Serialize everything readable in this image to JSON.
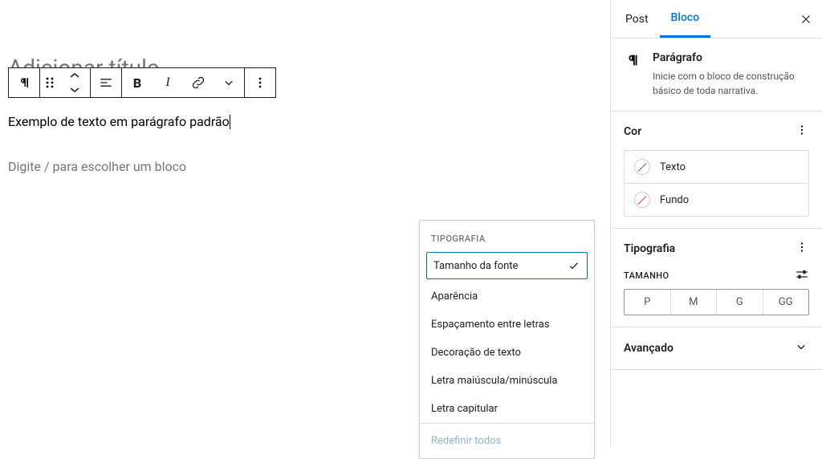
{
  "editor": {
    "title_placeholder": "Adicionar título",
    "paragraph_text": "Exemplo de texto em parágrafo padrão",
    "block_placeholder": "Digite / para escolher um bloco"
  },
  "popover": {
    "title": "TIPOGRAFIA",
    "items": [
      {
        "label": "Tamanho da fonte",
        "selected": true
      },
      {
        "label": "Aparência",
        "selected": false
      },
      {
        "label": "Espaçamento entre letras",
        "selected": false
      },
      {
        "label": "Decoração de texto",
        "selected": false
      },
      {
        "label": "Letra maiúscula/minúscula",
        "selected": false
      },
      {
        "label": "Letra capitular",
        "selected": false
      }
    ],
    "reset": "Redefinir todos"
  },
  "sidebar": {
    "tabs": {
      "post": "Post",
      "block": "Bloco"
    },
    "block": {
      "title": "Parágrafo",
      "desc": "Inicie com o bloco de construção básico de toda narrativa."
    },
    "color": {
      "title": "Cor",
      "text": "Texto",
      "background": "Fundo"
    },
    "typography": {
      "title": "Tipografia",
      "size_label": "TAMANHO",
      "sizes": [
        "P",
        "M",
        "G",
        "GG"
      ]
    },
    "advanced": "Avançado"
  }
}
